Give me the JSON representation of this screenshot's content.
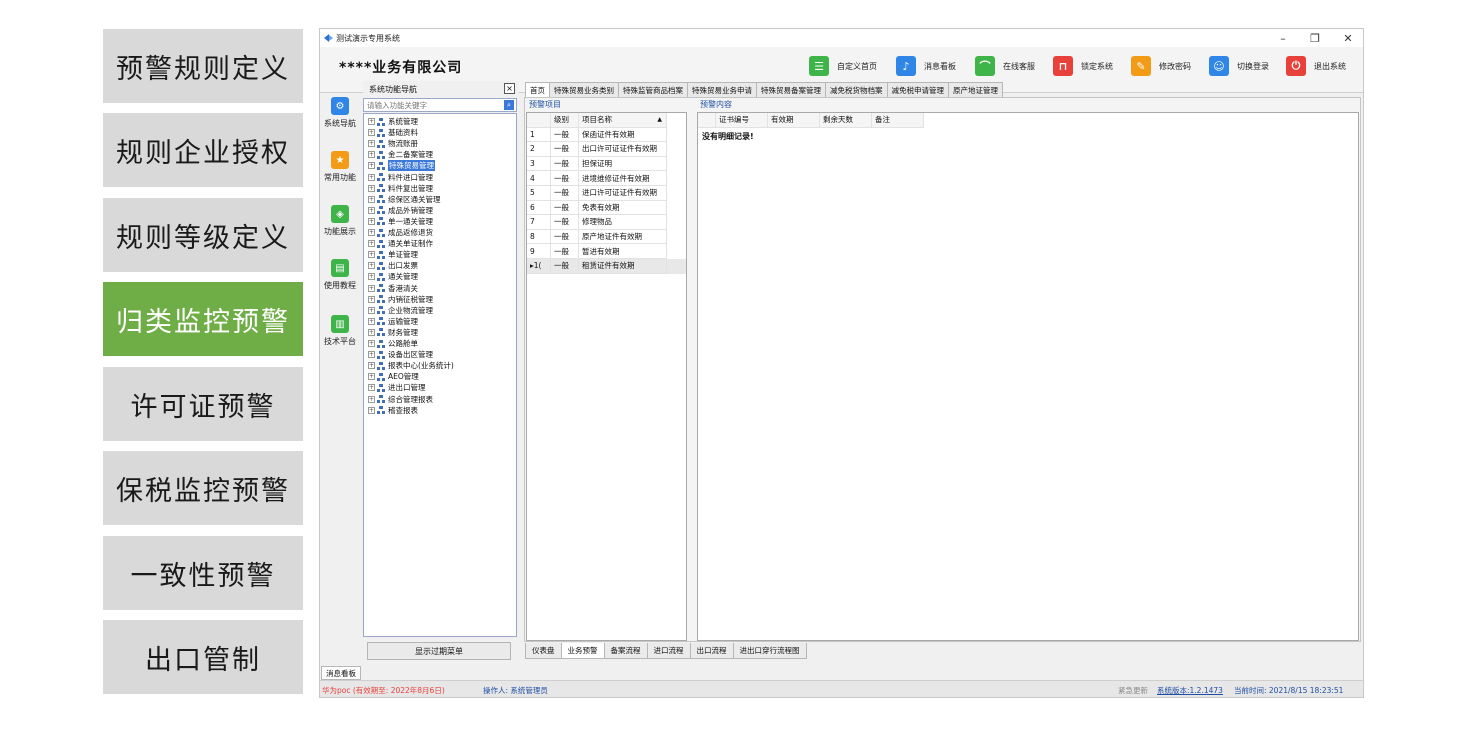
{
  "feature_menu": [
    {
      "label": "预警规则定义"
    },
    {
      "label": "规则企业授权"
    },
    {
      "label": "规则等级定义"
    },
    {
      "label": "归类监控预警"
    },
    {
      "label": "许可证预警"
    },
    {
      "label": "保税监控预警"
    },
    {
      "label": "一致性预警"
    },
    {
      "label": "出口管制"
    }
  ],
  "active_feature": "归类监控预警",
  "window": {
    "title": "测试演示专用系统",
    "controls": {
      "minimize": "–",
      "restore": "❐",
      "close": "✕"
    }
  },
  "header": {
    "company": "****业务有限公司",
    "toolbar": [
      {
        "label": "自定义首页",
        "icon": "home-grid-icon",
        "color": "#3fb449",
        "glyph": "☰"
      },
      {
        "label": "消息看板",
        "icon": "bell-icon",
        "color": "#2f86e6",
        "glyph": "🔔"
      },
      {
        "label": "在线客服",
        "icon": "headset-icon",
        "color": "#3fb449",
        "glyph": "☊"
      },
      {
        "label": "锁定系统",
        "icon": "lock-icon",
        "color": "#e8413b",
        "glyph": "🔒"
      },
      {
        "label": "修改密码",
        "icon": "edit-icon",
        "color": "#f29b16",
        "glyph": "✎"
      },
      {
        "label": "切换登录",
        "icon": "user-switch-icon",
        "color": "#2f86e6",
        "glyph": "👤"
      },
      {
        "label": "退出系统",
        "icon": "power-icon",
        "color": "#e8413b",
        "glyph": "⏻"
      }
    ]
  },
  "left_nav": [
    {
      "label": "系统导航",
      "icon": "gear-icon",
      "color": "#2f86e6",
      "glyph": "⚙"
    },
    {
      "label": "常用功能",
      "icon": "star-folder-icon",
      "color": "#f29b16",
      "glyph": "★"
    },
    {
      "label": "功能展示",
      "icon": "cube-icon",
      "color": "#3fb449",
      "glyph": "◈"
    },
    {
      "label": "使用教程",
      "icon": "book-icon",
      "color": "#3fb449",
      "glyph": "▤"
    },
    {
      "label": "技术平台",
      "icon": "printer-icon",
      "color": "#3fb449",
      "glyph": "▥"
    }
  ],
  "tree_panel": {
    "title": "系统功能导航",
    "close": "×",
    "search_placeholder": "请输入功能关键字",
    "search_button": "🔍",
    "nodes": [
      "系统管理",
      "基础资料",
      "物流账册",
      "金二备案管理",
      "特殊贸易管理",
      "料件进口管理",
      "料件复出管理",
      "综保区通关管理",
      "成品外销管理",
      "单一通关管理",
      "成品返修退货",
      "通关单证制作",
      "单证管理",
      "出口发票",
      "通关管理",
      "香港清关",
      "内销征税管理",
      "企业物流管理",
      "运输管理",
      "财务管理",
      "公路舱单",
      "设备出区管理",
      "报表中心(业务统计)",
      "AEO管理",
      "进出口管理",
      "综合管理报表",
      "稽查报表"
    ],
    "selected": "特殊贸易管理",
    "footer_button": "显示过期菜单"
  },
  "tabs": [
    "首页",
    "特殊贸易业务类别",
    "特殊监管商品档案",
    "特殊贸易业务申请",
    "特殊贸易备案管理",
    "减免税货物档案",
    "减免税申请管理",
    "原产地证管理"
  ],
  "active_tab": "首页",
  "warning_items": {
    "title": "预警项目",
    "columns": [
      "级别",
      "项目名称"
    ],
    "sort_glyph": "▲",
    "rows": [
      {
        "no": "1",
        "level": "一般",
        "name": "保函证件有效期"
      },
      {
        "no": "2",
        "level": "一般",
        "name": "出口许可证证件有效期"
      },
      {
        "no": "3",
        "level": "一般",
        "name": "担保证明"
      },
      {
        "no": "4",
        "level": "一般",
        "name": "进境维修证件有效期"
      },
      {
        "no": "5",
        "level": "一般",
        "name": "进口许可证证件有效期"
      },
      {
        "no": "6",
        "level": "一般",
        "name": "免表有效期"
      },
      {
        "no": "7",
        "level": "一般",
        "name": "修理物品"
      },
      {
        "no": "8",
        "level": "一般",
        "name": "原产地证件有效期"
      },
      {
        "no": "9",
        "level": "一般",
        "name": "暂进有效期"
      },
      {
        "no": "▸1(",
        "level": "一般",
        "name": "租赁证件有效期"
      }
    ]
  },
  "warning_content": {
    "title": "预警内容",
    "columns": [
      "证书编号",
      "有效期",
      "剩余天数",
      "备注"
    ],
    "empty_text": "没有明细记录!"
  },
  "bottom_tabs": [
    "仪表盘",
    "业务预警",
    "备案流程",
    "进口流程",
    "出口流程",
    "进出口穿行流程图"
  ],
  "active_bottom_tab": "业务预警",
  "message_tab": "消息看板",
  "status": {
    "license": "华为poc (有效期至: 2022年8月6日)",
    "operator": "操作人: 系统管理员",
    "update": "紧急更新",
    "version": "系统版本:1.2.1473",
    "time": "当前时间: 2021/8/15 18:23:51"
  },
  "colors": {
    "active_feature": "#6fad46",
    "feature_bg": "#d9d9d9",
    "selection": "#3b78d8",
    "license_text": "#e8413b",
    "operator_text": "#1f4fa5"
  }
}
